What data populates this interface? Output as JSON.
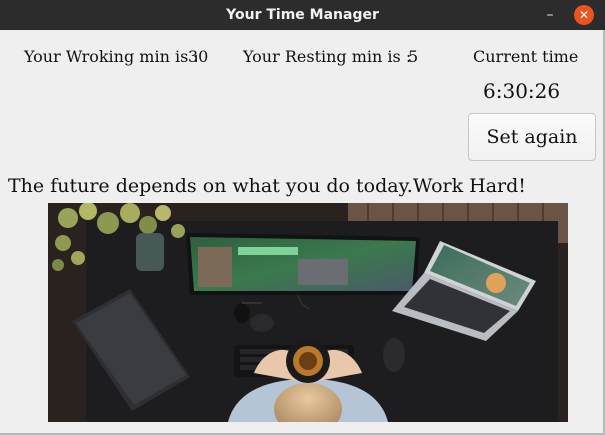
{
  "window": {
    "title": "Your Time Manager",
    "minimize_glyph": "–",
    "close_glyph": "✕"
  },
  "stats": {
    "working_label": "Your Wroking min is :",
    "working_value": "30",
    "resting_label": "Your Resting min is :",
    "resting_value": "5",
    "current_time_label": "Current time",
    "current_time_value": "6:30:26"
  },
  "actions": {
    "set_again_label": "Set again"
  },
  "motto": "The future depends on what you do today.Work Hard!",
  "image": {
    "icon": "desk-workspace-photo"
  },
  "colors": {
    "titlebar": "#2c2c2c",
    "close_button": "#e95420",
    "window_bg": "#efefef"
  }
}
